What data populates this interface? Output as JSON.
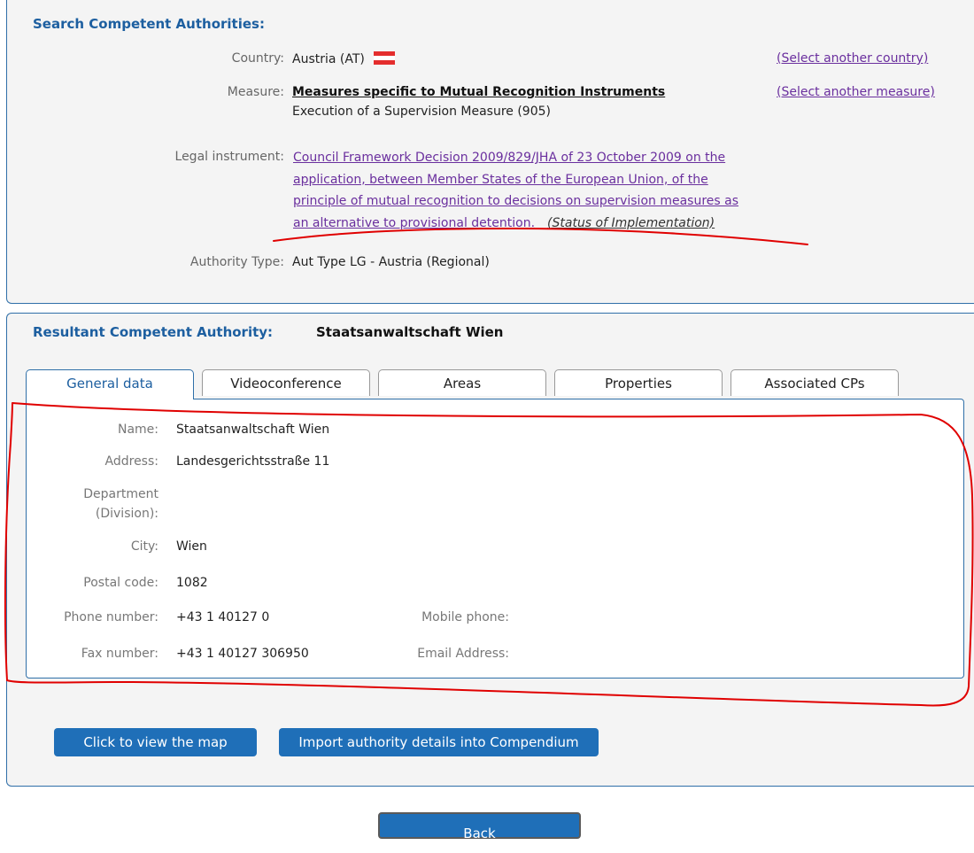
{
  "search": {
    "title": "Search Competent Authorities:",
    "country_label": "Country:",
    "country_value": "Austria (AT)",
    "select_country": "(Select another country)",
    "measure_label": "Measure:",
    "measure_value": "Measures specific to Mutual Recognition Instruments",
    "measure_sub": "Execution of a Supervision Measure (905)",
    "select_measure": "(Select another measure)",
    "legal_label": "Legal instrument:",
    "legal_link": "Council Framework Decision 2009/829/JHA of 23 October 2009 on the application, between Member States of the European Union, of the principle of mutual recognition to decisions on supervision measures as an alternative to provisional detention.",
    "status_link": "(Status of Implementation)",
    "authority_type_label": "Authority Type:",
    "authority_type_value": "Aut Type LG - Austria (Regional)"
  },
  "result": {
    "title": "Resultant Competent Authority:",
    "authority_name": "Staatsanwaltschaft Wien",
    "tabs": [
      "General data",
      "Videoconference",
      "Areas",
      "Properties",
      "Associated CPs"
    ],
    "general": {
      "name_label": "Name:",
      "name_value": "Staatsanwaltschaft Wien",
      "address_label": "Address:",
      "address_value": "Landesgerichtsstraße 11",
      "department_label_1": "Department",
      "department_label_2": "(Division):",
      "department_value": "",
      "city_label": "City:",
      "city_value": "Wien",
      "postal_label": "Postal code:",
      "postal_value": "1082",
      "phone_label": "Phone number:",
      "phone_value": "+43 1 40127 0",
      "mobile_label": "Mobile phone:",
      "mobile_value": "",
      "fax_label": "Fax number:",
      "fax_value": "+43 1 40127 306950",
      "email_label": "Email Address:",
      "email_value": ""
    },
    "buttons": {
      "view_map": "Click to view the map",
      "import": "Import authority details into Compendium"
    }
  },
  "back_label": "Back",
  "colors": {
    "accent": "#1f6fb8",
    "link": "#6a2f9e",
    "annotation": "#e00000",
    "flag_red": "#e42d2d"
  }
}
